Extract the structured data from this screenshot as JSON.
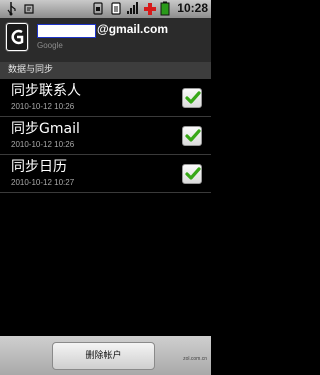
{
  "status_bar": {
    "time": "10:28",
    "left_icons": [
      "usb-icon",
      "notification-icon"
    ],
    "right_icons": [
      "sim-icon",
      "wifi-icon",
      "signal-icon",
      "plus-icon",
      "battery-icon"
    ]
  },
  "account": {
    "email_domain": "@gmail.com",
    "account_type": "Google",
    "logo_icon": "google-g-icon"
  },
  "section": {
    "label": "数据与同步"
  },
  "sync_items": [
    {
      "label": "同步联系人",
      "timestamp": "2010-10-12 10:26",
      "checked": true
    },
    {
      "label": "同步Gmail",
      "timestamp": "2010-10-12 10:26",
      "checked": true
    },
    {
      "label": "同步日历",
      "timestamp": "2010-10-12 10:27",
      "checked": true
    }
  ],
  "bottom": {
    "remove_button_label": "删除帐户",
    "watermark": "zol.com.cn"
  },
  "colors": {
    "check_green": "#38a818",
    "header_bg": "#2b2b2b",
    "section_bg": "#3d3d3d"
  }
}
